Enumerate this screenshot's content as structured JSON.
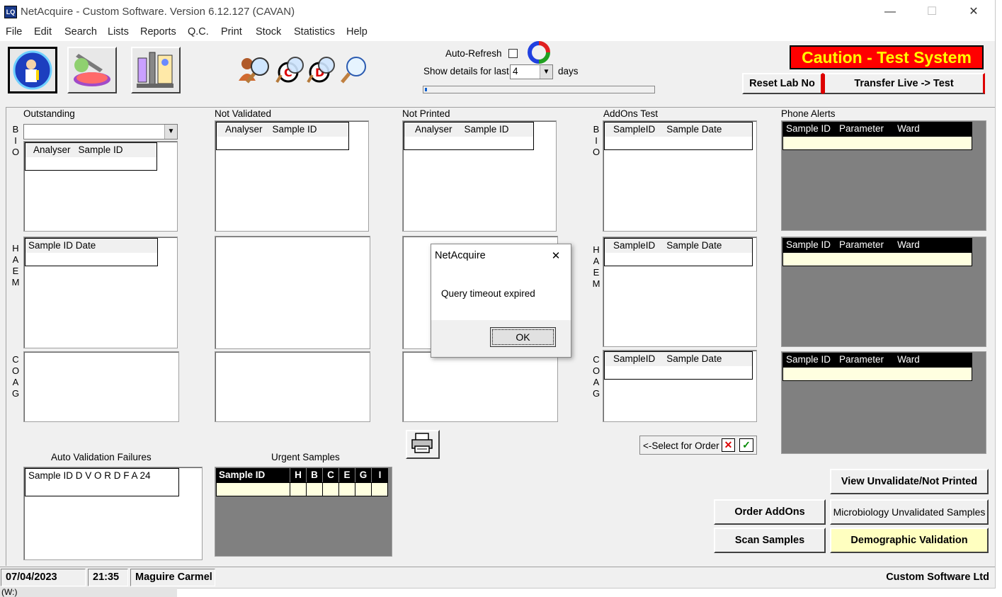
{
  "window": {
    "title": "NetAcquire - Custom Software. Version 6.12.127 (CAVAN)",
    "app_icon_text": "LQ",
    "minimize_glyph": "—",
    "maximize_glyph": "☐",
    "close_glyph": "✕"
  },
  "menu": [
    "File",
    "Edit",
    "Search",
    "Lists",
    "Reports",
    "Q.C.",
    "Print",
    "Stock",
    "Statistics",
    "Help"
  ],
  "toolbar": {
    "auto_refresh_label": "Auto-Refresh",
    "auto_refresh_checked": false,
    "show_details_label": "Show details for last",
    "days_value": "4",
    "days_label": "days",
    "progress": 0.01
  },
  "caution_banner": {
    "text": "Caution - Test System",
    "bg": "#ff0000",
    "fg": "#ffff00"
  },
  "buttons": {
    "reset_lab_no": "Reset Lab No",
    "transfer": "Transfer Live -> Test",
    "select_for_order": "<-Select for Order",
    "view_unvalidate": "View Unvalidate/Not Printed",
    "order_addons": "Order AddOns",
    "micro_unvalidated": "Microbiology Unvalidated Samples",
    "scan_samples": "Scan Samples",
    "demographic_validation": "Demographic Validation"
  },
  "sections": {
    "outstanding": "Outstanding",
    "not_validated": "Not Validated",
    "not_printed": "Not Printed",
    "addons_test": "AddOns Test",
    "phone_alerts": "Phone Alerts",
    "auto_validation_failures": "Auto Validation Failures",
    "urgent_samples": "Urgent Samples"
  },
  "row_labels": {
    "bio": [
      "B",
      "I",
      "O"
    ],
    "haem": [
      "H",
      "A",
      "E",
      "M"
    ],
    "coag": [
      "C",
      "O",
      "A",
      "G"
    ]
  },
  "headers": {
    "analyser": "Analyser",
    "sample_id": "Sample ID",
    "sample_id_date": "Sample ID  Date",
    "sampleid": "SampleID",
    "sample_date": "Sample Date",
    "parameter": "Parameter",
    "ward": "Ward",
    "avf": "Sample ID    D  V  O  R  D  F  A  24",
    "urgent_cols": [
      "Sample ID",
      "H",
      "B",
      "C",
      "E",
      "G",
      "I"
    ]
  },
  "dialog": {
    "title": "NetAcquire",
    "message": "Query timeout expired",
    "ok": "OK",
    "close_glyph": "✕"
  },
  "status": {
    "date": "07/04/2023",
    "time": "21:35",
    "user": "Maguire Carmel",
    "company": "Custom Software Ltd",
    "below": "(W:)"
  },
  "icons": [
    "scientist-icon",
    "pipette-icon",
    "microscope-lab-icon",
    "search-person-icon",
    "search-c-icon",
    "search-d-icon",
    "search-icon",
    "refresh-icon",
    "printer-icon"
  ]
}
